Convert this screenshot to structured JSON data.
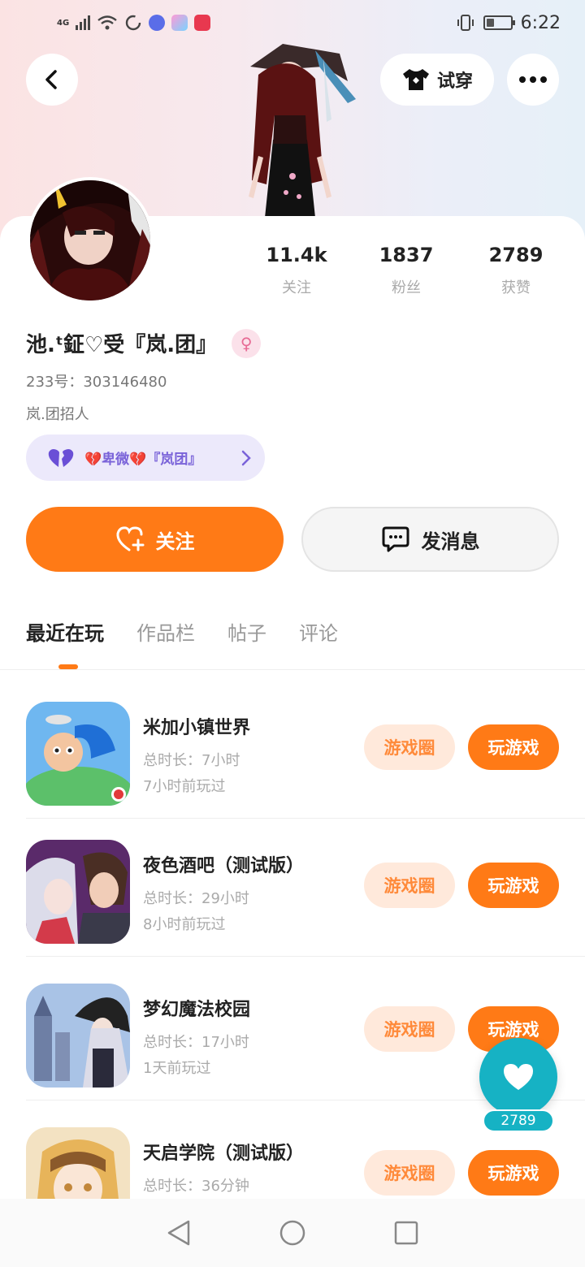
{
  "status_bar": {
    "network": "4G",
    "time": "6:22",
    "battery_level": 0.35
  },
  "header": {
    "tryon_label": "试穿"
  },
  "profile": {
    "name": "池.ᵗ鉦♡受『岚.团』",
    "uid": "233号：303146480",
    "bio": "岚.团招人",
    "gender_icon": "female-icon",
    "group_label": "💔卑微💔『岚团』"
  },
  "stats": [
    {
      "value": "11.4k",
      "label": "关注"
    },
    {
      "value": "1837",
      "label": "粉丝"
    },
    {
      "value": "2789",
      "label": "获赞"
    }
  ],
  "actions": {
    "follow_label": "关注",
    "message_label": "发消息"
  },
  "tabs": [
    "最近在玩",
    "作品栏",
    "帖子",
    "评论"
  ],
  "games": [
    {
      "name": "米加小镇世界",
      "duration": "总时长：7小时",
      "last_played": "7小时前玩过",
      "circle_label": "游戏圈",
      "play_label": "玩游戏"
    },
    {
      "name": "夜色酒吧（测试版）",
      "duration": "总时长：29小时",
      "last_played": "8小时前玩过",
      "circle_label": "游戏圈",
      "play_label": "玩游戏"
    },
    {
      "name": "梦幻魔法校园",
      "duration": "总时长：17小时",
      "last_played": "1天前玩过",
      "circle_label": "游戏圈",
      "play_label": "玩游戏"
    },
    {
      "name": "天启学院（测试版）",
      "duration": "总时长：36分钟",
      "last_played": "",
      "circle_label": "游戏圈",
      "play_label": "玩游戏"
    }
  ],
  "fab": {
    "count": "2789"
  },
  "colors": {
    "accent": "#ff7a16",
    "fab": "#16b2c4",
    "group": "#7a63d9"
  }
}
